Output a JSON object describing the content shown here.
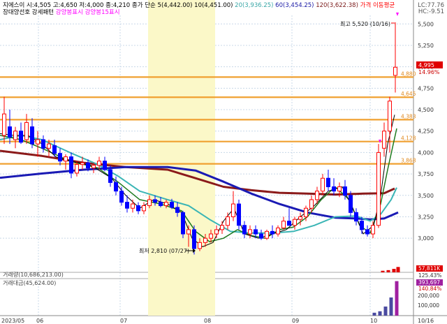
{
  "header": {
    "line1": [
      {
        "text": "지에스이 시:4,505 고:4,650 저:4,000 종:4,210",
        "color": "#000000"
      },
      {
        "text": "종가 단순 5(4,442.00)",
        "color": "#000000"
      },
      {
        "text": "10(4,451.00)",
        "color": "#000000"
      },
      {
        "text": "20(3,936.25)",
        "color": "#3aa7a7"
      },
      {
        "text": "60(3,454.25)",
        "color": "#1a1aa6"
      },
      {
        "text": "120(3,622.38)",
        "color": "#7a1a1a"
      },
      {
        "text": "가격 이동평균",
        "color": "#ff0000"
      }
    ],
    "line2": [
      {
        "text": "장대양선호 강세패턴",
        "color": "#000000"
      },
      {
        "text": "강양봉표시",
        "color": "#ff00ff"
      },
      {
        "text": "강양봉15표시",
        "color": "#ff00ff"
      }
    ],
    "lc": "LC:77.76",
    "hc": "HC:-9.51"
  },
  "annotations": {
    "high": "최고 5,520 (10/16)",
    "low": "최저 2,810 (07/27)"
  },
  "price_axis": {
    "ticks": [
      "5,500",
      "5,250",
      "5,000",
      "4,750",
      "4,500",
      "4,250",
      "4,000",
      "3,750",
      "3,500",
      "3,250",
      "3,000"
    ],
    "current_price": "4,995",
    "current_pct": "14.96%"
  },
  "levels": [
    "4,880",
    "4,645",
    "4,383",
    "4,128",
    "3,868"
  ],
  "volume": {
    "label": "거래량(10,686,213.00)",
    "value": "57,811K",
    "pct": "125.43%"
  },
  "amount": {
    "label": "거래대금(45,624.00)",
    "value": "393,697",
    "pct": "140.84%",
    "ticks": [
      "200,000",
      "100,000"
    ]
  },
  "x_axis": {
    "labels": [
      "2023/05",
      "06",
      "07",
      "08",
      "09",
      "10",
      "10/16"
    ]
  },
  "colors": {
    "up": "#ff0000",
    "down": "#0000ff",
    "ma5": "#000000",
    "ma10": "#1e7a1e",
    "ma20": "#3ab5b5",
    "ma60": "#1a1ab4",
    "ma120": "#8b1a1a",
    "level_line": "#f0a030",
    "highlight": "#fbf8c8",
    "badge": "#e00000",
    "amount_badge": "#a020a0",
    "magenta": "#ff00ff"
  },
  "chart_data": {
    "type": "line",
    "ylim": [
      2800,
      5520
    ],
    "ma60": [
      [
        0,
        3705
      ],
      [
        60,
        3755
      ],
      [
        120,
        3800
      ],
      [
        180,
        3830
      ],
      [
        240,
        3830
      ],
      [
        280,
        3790
      ],
      [
        320,
        3660
      ],
      [
        360,
        3520
      ],
      [
        400,
        3400
      ],
      [
        440,
        3300
      ],
      [
        480,
        3240
      ],
      [
        510,
        3230
      ],
      [
        530,
        3220
      ],
      [
        550,
        3230
      ],
      [
        570,
        3300
      ]
    ],
    "ma120": [
      [
        0,
        4020
      ],
      [
        60,
        3960
      ],
      [
        120,
        3880
      ],
      [
        180,
        3830
      ],
      [
        240,
        3800
      ],
      [
        280,
        3700
      ],
      [
        320,
        3600
      ],
      [
        360,
        3560
      ],
      [
        400,
        3530
      ],
      [
        440,
        3520
      ],
      [
        480,
        3510
      ],
      [
        520,
        3520
      ],
      [
        550,
        3525
      ],
      [
        565,
        3580
      ]
    ],
    "ma20": [
      [
        0,
        4150
      ],
      [
        30,
        4200
      ],
      [
        60,
        4150
      ],
      [
        100,
        4000
      ],
      [
        140,
        3860
      ],
      [
        170,
        3720
      ],
      [
        200,
        3550
      ],
      [
        240,
        3450
      ],
      [
        270,
        3380
      ],
      [
        300,
        3220
      ],
      [
        330,
        3080
      ],
      [
        360,
        3060
      ],
      [
        390,
        3060
      ],
      [
        420,
        3080
      ],
      [
        450,
        3150
      ],
      [
        480,
        3250
      ],
      [
        510,
        3260
      ],
      [
        530,
        3200
      ],
      [
        545,
        3280
      ],
      [
        560,
        3450
      ],
      [
        568,
        3590
      ]
    ],
    "ma10": [
      [
        0,
        4200
      ],
      [
        30,
        4150
      ],
      [
        60,
        4050
      ],
      [
        100,
        3900
      ],
      [
        140,
        3820
      ],
      [
        170,
        3650
      ],
      [
        200,
        3450
      ],
      [
        230,
        3400
      ],
      [
        260,
        3320
      ],
      [
        280,
        3080
      ],
      [
        300,
        2960
      ],
      [
        320,
        3000
      ],
      [
        340,
        3100
      ],
      [
        360,
        3030
      ],
      [
        380,
        3000
      ],
      [
        400,
        3100
      ],
      [
        420,
        3130
      ],
      [
        440,
        3250
      ],
      [
        460,
        3450
      ],
      [
        480,
        3600
      ],
      [
        500,
        3450
      ],
      [
        515,
        3150
      ],
      [
        530,
        3060
      ],
      [
        545,
        3400
      ],
      [
        555,
        3800
      ],
      [
        568,
        4280
      ]
    ],
    "ma5": [
      [
        0,
        4220
      ],
      [
        20,
        4200
      ],
      [
        40,
        4200
      ],
      [
        60,
        4100
      ],
      [
        80,
        3950
      ],
      [
        100,
        3900
      ],
      [
        130,
        3850
      ],
      [
        160,
        3700
      ],
      [
        180,
        3500
      ],
      [
        200,
        3350
      ],
      [
        220,
        3450
      ],
      [
        240,
        3400
      ],
      [
        260,
        3300
      ],
      [
        275,
        3000
      ],
      [
        290,
        2900
      ],
      [
        305,
        2950
      ],
      [
        320,
        3200
      ],
      [
        335,
        3350
      ],
      [
        350,
        3050
      ],
      [
        370,
        3000
      ],
      [
        390,
        3050
      ],
      [
        410,
        3100
      ],
      [
        430,
        3250
      ],
      [
        450,
        3380
      ],
      [
        470,
        3550
      ],
      [
        490,
        3600
      ],
      [
        505,
        3350
      ],
      [
        520,
        3050
      ],
      [
        535,
        3150
      ],
      [
        545,
        3500
      ],
      [
        555,
        4100
      ],
      [
        565,
        4440
      ]
    ],
    "candles": [
      {
        "x": 6,
        "o": 4200,
        "h": 4650,
        "l": 4100,
        "c": 4450
      },
      {
        "x": 14,
        "o": 4300,
        "h": 4500,
        "l": 4100,
        "c": 4180
      },
      {
        "x": 22,
        "o": 4150,
        "h": 4300,
        "l": 4050,
        "c": 4250
      },
      {
        "x": 30,
        "o": 4250,
        "h": 4350,
        "l": 4100,
        "c": 4120
      },
      {
        "x": 38,
        "o": 4150,
        "h": 4450,
        "l": 4100,
        "c": 4350
      },
      {
        "x": 46,
        "o": 4300,
        "h": 4400,
        "l": 4050,
        "c": 4100
      },
      {
        "x": 54,
        "o": 4100,
        "h": 4250,
        "l": 3950,
        "c": 4150
      },
      {
        "x": 62,
        "o": 4150,
        "h": 4200,
        "l": 4000,
        "c": 4050
      },
      {
        "x": 70,
        "o": 4050,
        "h": 4150,
        "l": 3950,
        "c": 4100
      },
      {
        "x": 78,
        "o": 4080,
        "h": 4150,
        "l": 3950,
        "c": 3990
      },
      {
        "x": 86,
        "o": 3990,
        "h": 4050,
        "l": 3850,
        "c": 3900
      },
      {
        "x": 94,
        "o": 3900,
        "h": 3980,
        "l": 3800,
        "c": 3950
      },
      {
        "x": 102,
        "o": 3950,
        "h": 4000,
        "l": 3700,
        "c": 3760
      },
      {
        "x": 110,
        "o": 3760,
        "h": 3900,
        "l": 3720,
        "c": 3860
      },
      {
        "x": 118,
        "o": 3860,
        "h": 3950,
        "l": 3800,
        "c": 3880
      },
      {
        "x": 126,
        "o": 3880,
        "h": 3920,
        "l": 3780,
        "c": 3820
      },
      {
        "x": 134,
        "o": 3820,
        "h": 3880,
        "l": 3760,
        "c": 3850
      },
      {
        "x": 142,
        "o": 3850,
        "h": 3950,
        "l": 3800,
        "c": 3900
      },
      {
        "x": 150,
        "o": 3900,
        "h": 3950,
        "l": 3780,
        "c": 3800
      },
      {
        "x": 158,
        "o": 3800,
        "h": 3850,
        "l": 3600,
        "c": 3650
      },
      {
        "x": 166,
        "o": 3650,
        "h": 3720,
        "l": 3500,
        "c": 3550
      },
      {
        "x": 174,
        "o": 3550,
        "h": 3600,
        "l": 3380,
        "c": 3420
      },
      {
        "x": 182,
        "o": 3420,
        "h": 3500,
        "l": 3300,
        "c": 3350
      },
      {
        "x": 190,
        "o": 3350,
        "h": 3450,
        "l": 3300,
        "c": 3400
      },
      {
        "x": 198,
        "o": 3380,
        "h": 3420,
        "l": 3280,
        "c": 3320
      },
      {
        "x": 206,
        "o": 3320,
        "h": 3420,
        "l": 3280,
        "c": 3380
      },
      {
        "x": 214,
        "o": 3380,
        "h": 3500,
        "l": 3350,
        "c": 3450
      },
      {
        "x": 222,
        "o": 3450,
        "h": 3500,
        "l": 3380,
        "c": 3420
      },
      {
        "x": 230,
        "o": 3420,
        "h": 3480,
        "l": 3360,
        "c": 3380
      },
      {
        "x": 238,
        "o": 3380,
        "h": 3450,
        "l": 3350,
        "c": 3420
      },
      {
        "x": 246,
        "o": 3420,
        "h": 3460,
        "l": 3340,
        "c": 3360
      },
      {
        "x": 254,
        "o": 3360,
        "h": 3420,
        "l": 3250,
        "c": 3300
      },
      {
        "x": 262,
        "o": 3300,
        "h": 3320,
        "l": 3000,
        "c": 3050
      },
      {
        "x": 270,
        "o": 3050,
        "h": 3150,
        "l": 2900,
        "c": 3100
      },
      {
        "x": 278,
        "o": 3100,
        "h": 3150,
        "l": 2810,
        "c": 2880
      },
      {
        "x": 286,
        "o": 2880,
        "h": 3000,
        "l": 2850,
        "c": 2950
      },
      {
        "x": 294,
        "o": 2950,
        "h": 3050,
        "l": 2900,
        "c": 3000
      },
      {
        "x": 302,
        "o": 3000,
        "h": 3100,
        "l": 2950,
        "c": 3050
      },
      {
        "x": 310,
        "o": 3050,
        "h": 3150,
        "l": 3000,
        "c": 3100
      },
      {
        "x": 318,
        "o": 3100,
        "h": 3200,
        "l": 3050,
        "c": 3150
      },
      {
        "x": 326,
        "o": 3150,
        "h": 3300,
        "l": 3100,
        "c": 3250
      },
      {
        "x": 334,
        "o": 3250,
        "h": 3550,
        "l": 3200,
        "c": 3400
      },
      {
        "x": 342,
        "o": 3400,
        "h": 3450,
        "l": 3100,
        "c": 3150
      },
      {
        "x": 350,
        "o": 3150,
        "h": 3200,
        "l": 3000,
        "c": 3050
      },
      {
        "x": 358,
        "o": 3050,
        "h": 3150,
        "l": 3000,
        "c": 3100
      },
      {
        "x": 366,
        "o": 3100,
        "h": 3150,
        "l": 3000,
        "c": 3050
      },
      {
        "x": 374,
        "o": 3050,
        "h": 3100,
        "l": 2980,
        "c": 3000
      },
      {
        "x": 382,
        "o": 3000,
        "h": 3100,
        "l": 2980,
        "c": 3080
      },
      {
        "x": 390,
        "o": 3080,
        "h": 3150,
        "l": 3000,
        "c": 3050
      },
      {
        "x": 398,
        "o": 3050,
        "h": 3150,
        "l": 3020,
        "c": 3120
      },
      {
        "x": 406,
        "o": 3120,
        "h": 3250,
        "l": 3100,
        "c": 3200
      },
      {
        "x": 414,
        "o": 3200,
        "h": 3350,
        "l": 3150,
        "c": 3150
      },
      {
        "x": 422,
        "o": 3150,
        "h": 3250,
        "l": 3100,
        "c": 3220
      },
      {
        "x": 430,
        "o": 3220,
        "h": 3300,
        "l": 3150,
        "c": 3250
      },
      {
        "x": 438,
        "o": 3250,
        "h": 3380,
        "l": 3200,
        "c": 3350
      },
      {
        "x": 446,
        "o": 3350,
        "h": 3500,
        "l": 3300,
        "c": 3450
      },
      {
        "x": 454,
        "o": 3450,
        "h": 3600,
        "l": 3400,
        "c": 3550
      },
      {
        "x": 462,
        "o": 3550,
        "h": 3750,
        "l": 3500,
        "c": 3700
      },
      {
        "x": 470,
        "o": 3700,
        "h": 3800,
        "l": 3550,
        "c": 3600
      },
      {
        "x": 478,
        "o": 3600,
        "h": 3700,
        "l": 3500,
        "c": 3550
      },
      {
        "x": 486,
        "o": 3550,
        "h": 3650,
        "l": 3480,
        "c": 3600
      },
      {
        "x": 494,
        "o": 3600,
        "h": 3680,
        "l": 3450,
        "c": 3500
      },
      {
        "x": 502,
        "o": 3500,
        "h": 3550,
        "l": 3250,
        "c": 3300
      },
      {
        "x": 510,
        "o": 3300,
        "h": 3350,
        "l": 3150,
        "c": 3200
      },
      {
        "x": 518,
        "o": 3200,
        "h": 3250,
        "l": 3050,
        "c": 3100
      },
      {
        "x": 526,
        "o": 3100,
        "h": 3150,
        "l": 3020,
        "c": 3050
      },
      {
        "x": 534,
        "o": 3050,
        "h": 3200,
        "l": 3000,
        "c": 3150
      },
      {
        "x": 542,
        "o": 3150,
        "h": 4100,
        "l": 3120,
        "c": 4000
      },
      {
        "x": 550,
        "o": 4050,
        "h": 4350,
        "l": 3950,
        "c": 4250
      },
      {
        "x": 558,
        "o": 4250,
        "h": 4650,
        "l": 4000,
        "c": 4600
      },
      {
        "x": 566,
        "o": 4900,
        "h": 5520,
        "l": 4700,
        "c": 4995
      }
    ],
    "volume_bars": [
      [
        548,
        0.25
      ],
      [
        556,
        0.35
      ],
      [
        564,
        0.55
      ],
      [
        570,
        0.85
      ]
    ],
    "amount_bars": [
      [
        536,
        0.08
      ],
      [
        544,
        0.12
      ],
      [
        552,
        0.25
      ],
      [
        560,
        0.5
      ],
      [
        568,
        0.95
      ]
    ]
  }
}
